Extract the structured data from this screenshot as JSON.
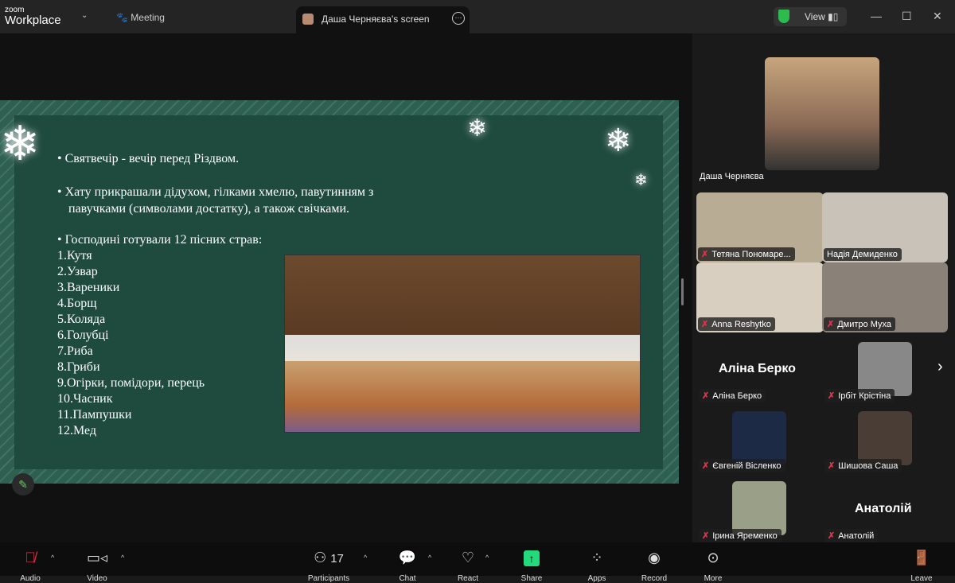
{
  "titlebar": {
    "logo_small": "zoom",
    "logo_big": "Workplace",
    "meeting_label": "Meeting",
    "screen_tab": "Даша Черняєва's screen",
    "view_label": "View"
  },
  "slide": {
    "bullets": [
      "Святвечір - вечір перед Різдвом.",
      "Хату прикрашали дідухом, гілками хмелю, павутинням з",
      "павучками (символами достатку), а також свічками.",
      "Господині  готували 12 пісних страв:"
    ],
    "dishes": [
      "1.Кутя",
      "2.Узвар",
      "3.Вареники",
      "4.Борщ",
      "5.Коляда",
      "6.Голубці",
      "7.Риба",
      "8.Гриби",
      "9.Огірки, помідори, перець",
      "10.Часник",
      "11.Пампушки",
      "12.Мед"
    ]
  },
  "participants": {
    "presenter": "Даша Черняєва",
    "grid": [
      "Тетяна Пономаре...",
      "Надія Демиденко",
      "Anna Reshytko",
      "Дмитро Муха"
    ],
    "gallery": [
      "Аліна Берко",
      "Ірбіт Крістіна",
      "Євгеній Вісленко",
      "Шишова Саша",
      "Ірина Яременко",
      "Анатолій"
    ],
    "big_names": [
      "Аліна Берко",
      "Анатолій"
    ]
  },
  "toolbar": {
    "audio": "Audio",
    "video": "Video",
    "participants": "Participants",
    "participants_count": "17",
    "chat": "Chat",
    "react": "React",
    "share": "Share",
    "apps": "Apps",
    "record": "Record",
    "more": "More",
    "leave": "Leave"
  }
}
